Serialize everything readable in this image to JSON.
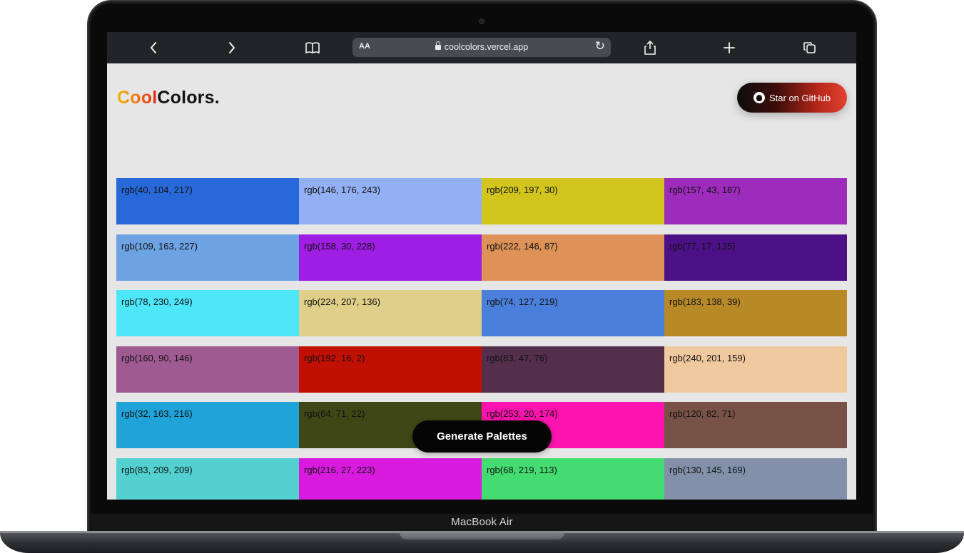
{
  "device": {
    "label": "MacBook Air"
  },
  "browser": {
    "text_size_label": "AA",
    "url": "coolcolors.vercel.app",
    "icons": [
      "chevron-left-icon",
      "chevron-right-icon",
      "book-icon",
      "reload-icon",
      "share-icon",
      "plus-icon",
      "tabs-icon"
    ]
  },
  "header": {
    "logo_part1": "Cool",
    "logo_part2": "Colors.",
    "github_button": "Star on GitHub"
  },
  "colors": {
    "logo_gradient": [
      "#f6b409",
      "#e2231a"
    ],
    "github_button_gradient": [
      "#0d0d0d",
      "#e2422f"
    ],
    "page_background": "#e6e6e6"
  },
  "palette_rows": [
    [
      {
        "label": "rgb(40, 104, 217)",
        "color": "#2868d9"
      },
      {
        "label": "rgb(146, 176, 243)",
        "color": "#92b0f3"
      },
      {
        "label": "rgb(209, 197, 30)",
        "color": "#d1c51e"
      },
      {
        "label": "rgb(157, 43, 187)",
        "color": "#9d2bbb"
      }
    ],
    [
      {
        "label": "rgb(109, 163, 227)",
        "color": "#6da3e3"
      },
      {
        "label": "rgb(158, 30, 228)",
        "color": "#9e1ee4"
      },
      {
        "label": "rgb(222, 146, 87)",
        "color": "#de9257"
      },
      {
        "label": "rgb(77, 17, 135)",
        "color": "#4d1187"
      }
    ],
    [
      {
        "label": "rgb(78, 230, 249)",
        "color": "#4ee6f9"
      },
      {
        "label": "rgb(224, 207, 136)",
        "color": "#e0cf88"
      },
      {
        "label": "rgb(74, 127, 219)",
        "color": "#4a7fdb"
      },
      {
        "label": "rgb(183, 138, 39)",
        "color": "#b78a27"
      }
    ],
    [
      {
        "label": "rgb(160, 90, 146)",
        "color": "#a05a92"
      },
      {
        "label": "rgb(192, 16, 2)",
        "color": "#c01002"
      },
      {
        "label": "rgb(83, 47, 76)",
        "color": "#532f4c"
      },
      {
        "label": "rgb(240, 201, 159)",
        "color": "#f0c99f"
      }
    ],
    [
      {
        "label": "rgb(32, 163, 216)",
        "color": "#20a3d8"
      },
      {
        "label": "rgb(64, 71, 22)",
        "color": "#404716"
      },
      {
        "label": "rgb(253, 20, 174)",
        "color": "#fd14ae"
      },
      {
        "label": "rgb(120, 82, 71)",
        "color": "#785247"
      }
    ],
    [
      {
        "label": "rgb(83, 209, 209)",
        "color": "#53d1d1"
      },
      {
        "label": "rgb(216, 27, 223)",
        "color": "#d81bdf"
      },
      {
        "label": "rgb(68, 219, 113)",
        "color": "#44db71"
      },
      {
        "label": "rgb(130, 145, 169)",
        "color": "#8291a9"
      }
    ]
  ],
  "generate_button": "Generate Palettes"
}
